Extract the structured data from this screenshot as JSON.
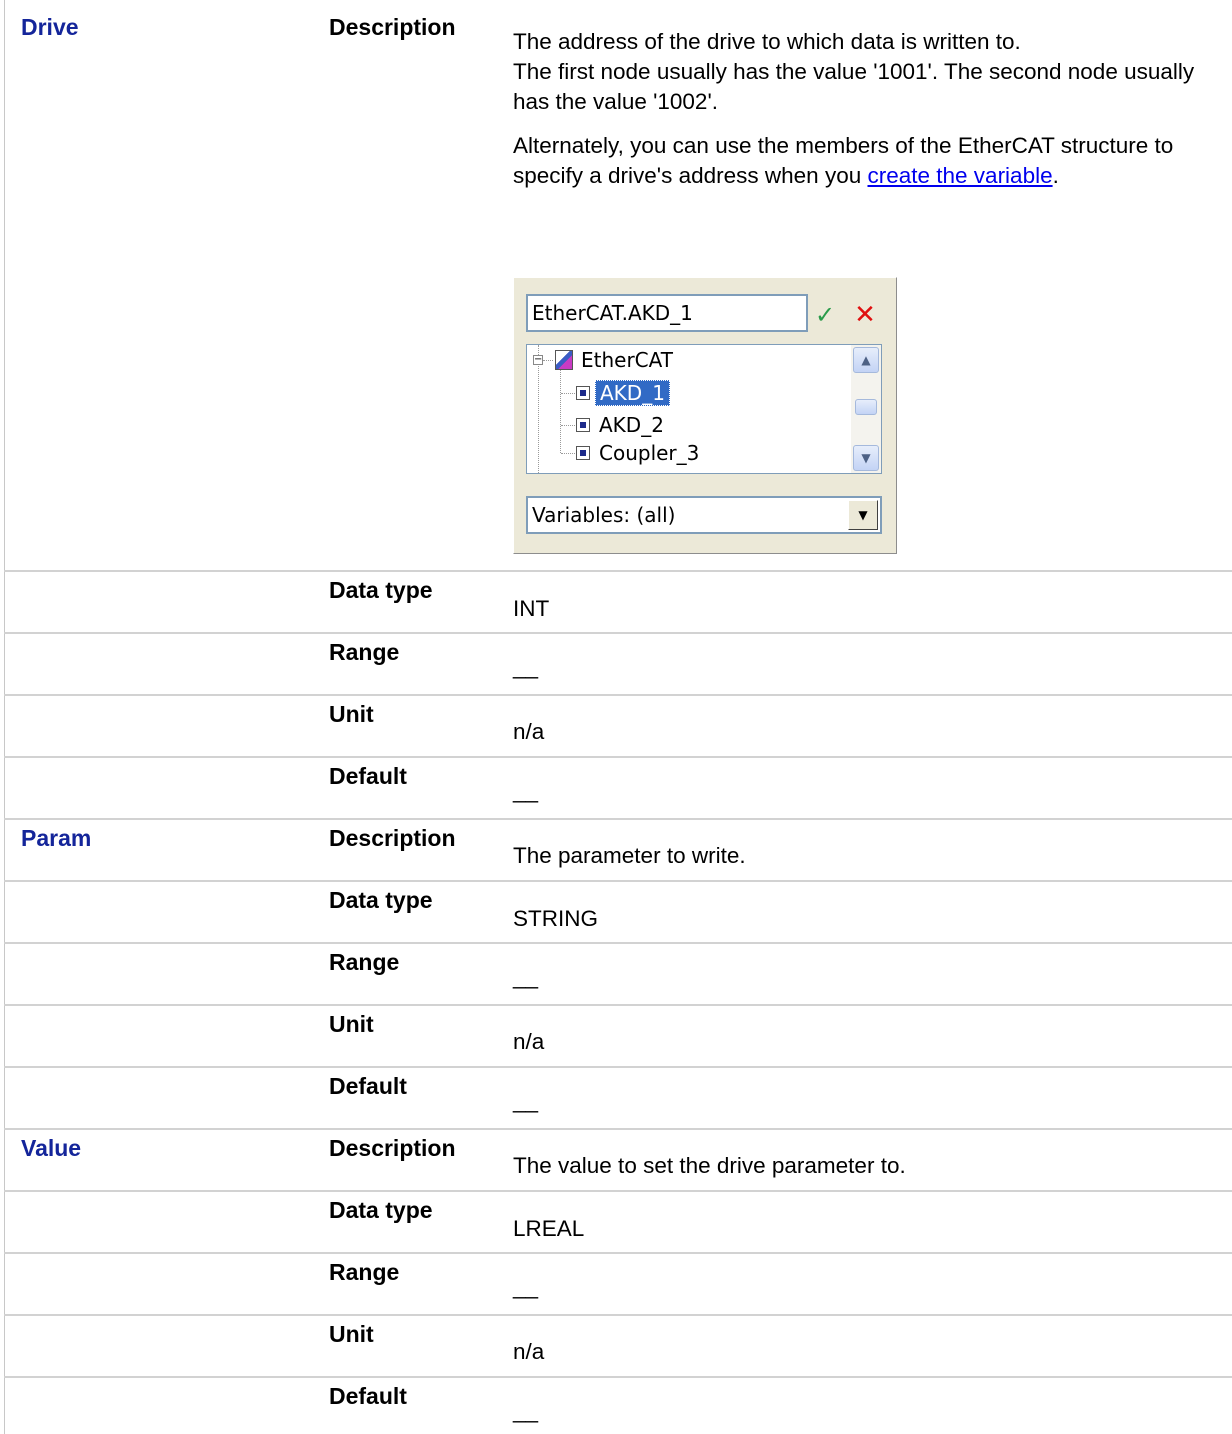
{
  "rows": [
    {
      "name": "Drive",
      "description_label": "Description",
      "description_lines": [
        "The address of the drive to which data is written to.",
        "The first node usually has the value '1001'. The second node usually has the value '1002'."
      ],
      "description_extra_before_link": "Alternately, you can use the members of the EtherCAT structure to specify a drive's address when you ",
      "description_link": "create the variable",
      "description_extra_after_link": ".",
      "datatype_label": "Data type",
      "datatype": "INT",
      "range_label": "Range",
      "range": "__",
      "unit_label": "Unit",
      "unit": "n/a",
      "default_label": "Default",
      "default": "__"
    },
    {
      "name": "Param",
      "description_label": "Description",
      "description": "The parameter to write.",
      "datatype_label": "Data type",
      "datatype": "STRING",
      "range_label": "Range",
      "range": "__",
      "unit_label": "Unit",
      "unit": "n/a",
      "default_label": "Default",
      "default": "__"
    },
    {
      "name": "Value",
      "description_label": "Description",
      "description": "The value to set the drive parameter to.",
      "datatype_label": "Data type",
      "datatype": "LREAL",
      "range_label": "Range",
      "range": "__",
      "unit_label": "Unit",
      "unit": "n/a",
      "default_label": "Default",
      "default": "__"
    }
  ],
  "picker": {
    "input_value": "EtherCAT.AKD_1",
    "ok_icon": "checkmark-icon",
    "cancel_icon": "close-icon",
    "tree": {
      "root": "EtherCAT",
      "children": [
        "AKD_1",
        "AKD_2",
        "Coupler_3"
      ],
      "selected": "AKD_1"
    },
    "filter_value": "Variables: (all)"
  }
}
